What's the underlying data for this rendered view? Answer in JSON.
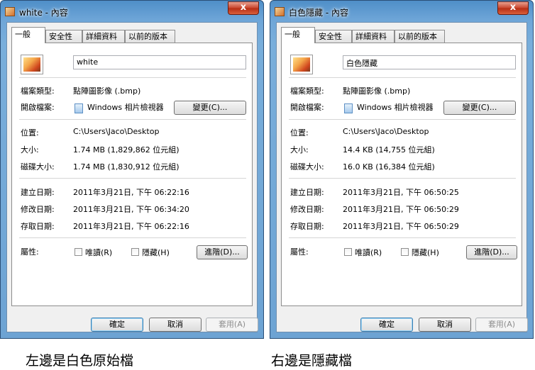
{
  "left": {
    "window_title": "white - 內容",
    "close_glyph": "x",
    "tabs": [
      "一般",
      "安全性",
      "詳細資料",
      "以前的版本"
    ],
    "file_name": "white",
    "file_type_label": "檔案類型:",
    "file_type_value": "點陣圖影像 (.bmp)",
    "opens_with_label": "開啟檔案:",
    "opens_with_value": "Windows 相片檢視器",
    "change_button": "變更(C)...",
    "location_label": "位置:",
    "location_value": "C:\\Users\\Jaco\\Desktop",
    "size_label": "大小:",
    "size_value": "1.74 MB (1,829,862 位元組)",
    "disk_size_label": "磁碟大小:",
    "disk_size_value": "1.74 MB (1,830,912 位元組)",
    "created_label": "建立日期:",
    "created_value": "2011年3月21日, 下午 06:22:16",
    "modified_label": "修改日期:",
    "modified_value": "2011年3月21日, 下午 06:34:20",
    "accessed_label": "存取日期:",
    "accessed_value": "2011年3月21日, 下午 06:22:16",
    "attributes_label": "屬性:",
    "readonly_label": "唯讀(R)",
    "hidden_label": "隱藏(H)",
    "advanced_button": "進階(D)...",
    "ok_button": "確定",
    "cancel_button": "取消",
    "apply_button": "套用(A)"
  },
  "right": {
    "window_title": "白色隱藏 - 內容",
    "close_glyph": "x",
    "tabs": [
      "一般",
      "安全性",
      "詳細資料",
      "以前的版本"
    ],
    "file_name": "白色隱藏",
    "file_type_label": "檔案類型:",
    "file_type_value": "點陣圖影像 (.bmp)",
    "opens_with_label": "開啟檔案:",
    "opens_with_value": "Windows 相片檢視器",
    "change_button": "變更(C)...",
    "location_label": "位置:",
    "location_value": "C:\\Users\\Jaco\\Desktop",
    "size_label": "大小:",
    "size_value": "14.4 KB (14,755 位元組)",
    "disk_size_label": "磁碟大小:",
    "disk_size_value": "16.0 KB (16,384 位元組)",
    "created_label": "建立日期:",
    "created_value": "2011年3月21日, 下午 06:50:25",
    "modified_label": "修改日期:",
    "modified_value": "2011年3月21日, 下午 06:50:29",
    "accessed_label": "存取日期:",
    "accessed_value": "2011年3月21日, 下午 06:50:29",
    "attributes_label": "屬性:",
    "readonly_label": "唯讀(R)",
    "hidden_label": "隱藏(H)",
    "advanced_button": "進階(D)...",
    "ok_button": "確定",
    "cancel_button": "取消",
    "apply_button": "套用(A)"
  },
  "captions": {
    "left": "左邊是白色原始檔",
    "right": "右邊是隱藏檔"
  },
  "colors": {
    "frame": "#6fa6d8",
    "close_button": "#c8432a"
  }
}
